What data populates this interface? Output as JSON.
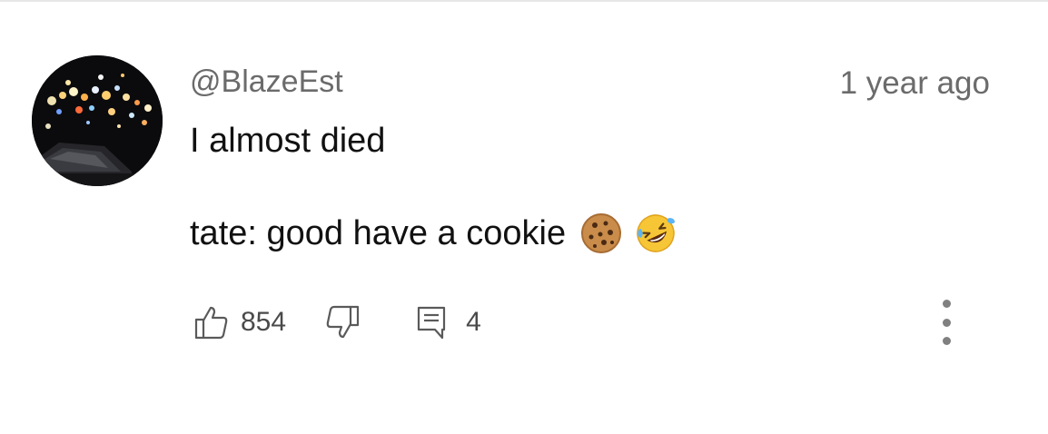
{
  "comment": {
    "author": "@BlazeEst",
    "timestamp": "1 year ago",
    "lines": [
      "I almost died",
      "tate: good have a cookie"
    ],
    "emojis": [
      "cookie-emoji",
      "rolling-on-floor-laughing-emoji"
    ],
    "likes": "854",
    "replies": "4"
  },
  "icons": {
    "like": "thumbs-up-icon",
    "dislike": "thumbs-down-icon",
    "reply": "comment-icon",
    "more": "more-vertical-icon"
  },
  "colors": {
    "text_primary": "#111111",
    "text_secondary": "#6b6b6b",
    "icon": "#5a5a5a"
  }
}
